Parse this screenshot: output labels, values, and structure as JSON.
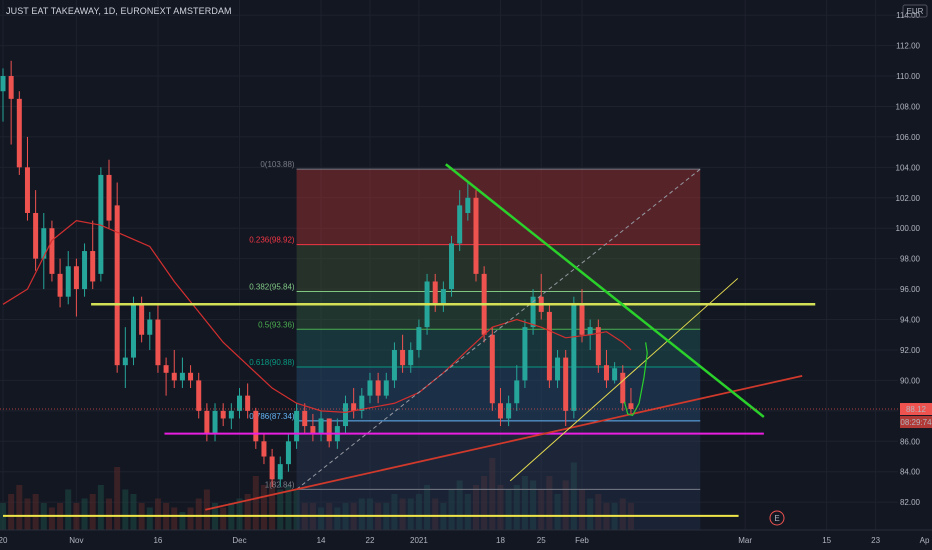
{
  "header": {
    "title": "JUST EAT TAKEAWAY, 1D, EURONEXT AMSTERDAM"
  },
  "currency": "EUR",
  "price_labels": {
    "current": {
      "value": 88.12,
      "text": "88.12",
      "countdown": "08:29:74"
    }
  },
  "event_marker": "E",
  "colors": {
    "background": "#131722",
    "up": "#26a69a",
    "down": "#ef5350",
    "ma": "#d32f2f",
    "green_line": "#2bd12b",
    "lime_line": "#d4e157",
    "magenta_line": "#e91ee0",
    "yellow_line": "#f0e64a",
    "red_trend": "#d0392b"
  },
  "chart_data": {
    "type": "candlestick",
    "title": "JUST EAT TAKEAWAY, 1D, EURONEXT AMSTERDAM",
    "xlabel": "",
    "ylabel": "",
    "ylim": [
      80.2,
      114.6
    ],
    "y_ticks": [
      82,
      84,
      86,
      88,
      90,
      92,
      94,
      96,
      98,
      100,
      102,
      104,
      106,
      108,
      110,
      112,
      114
    ],
    "y_tick_labels": [
      "82.00",
      "84.00",
      "86.00",
      "88.00",
      "90.00",
      "92.00",
      "94.00",
      "96.00",
      "98.00",
      "100.00",
      "102.00",
      "104.00",
      "106.00",
      "108.00",
      "110.00",
      "112.00",
      "114.00"
    ],
    "x_ticks": [
      {
        "label": "20",
        "i": 0
      },
      {
        "label": "Nov",
        "i": 9
      },
      {
        "label": "16",
        "i": 19
      },
      {
        "label": "Dec",
        "i": 29
      },
      {
        "label": "14",
        "i": 39
      },
      {
        "label": "22",
        "i": 45
      },
      {
        "label": "2021",
        "i": 51
      },
      {
        "label": "18",
        "i": 61
      },
      {
        "label": "25",
        "i": 66
      },
      {
        "label": "Feb",
        "i": 71
      },
      {
        "label": "Mar",
        "i": 91
      },
      {
        "label": "15",
        "i": 101
      },
      {
        "label": "23",
        "i": 107
      },
      {
        "label": "Ap",
        "i": 113
      }
    ],
    "candles": [
      {
        "o": 109,
        "h": 110.5,
        "l": 107,
        "c": 110
      },
      {
        "o": 110,
        "h": 111,
        "l": 105.5,
        "c": 108.5
      },
      {
        "o": 108.5,
        "h": 109,
        "l": 103.5,
        "c": 104
      },
      {
        "o": 104,
        "h": 106,
        "l": 100.5,
        "c": 101
      },
      {
        "o": 101,
        "h": 102.5,
        "l": 97.2,
        "c": 98
      },
      {
        "o": 98,
        "h": 101,
        "l": 96,
        "c": 100
      },
      {
        "o": 100,
        "h": 100.5,
        "l": 96.5,
        "c": 97
      },
      {
        "o": 97,
        "h": 98,
        "l": 94.8,
        "c": 95.5
      },
      {
        "o": 95.5,
        "h": 98.5,
        "l": 95,
        "c": 97.5
      },
      {
        "o": 97.5,
        "h": 98,
        "l": 94.2,
        "c": 96
      },
      {
        "o": 96,
        "h": 99,
        "l": 95.5,
        "c": 98.5
      },
      {
        "o": 98.5,
        "h": 100.5,
        "l": 96,
        "c": 96.5
      },
      {
        "o": 97,
        "h": 104,
        "l": 96.5,
        "c": 103.5
      },
      {
        "o": 103.5,
        "h": 104.5,
        "l": 100,
        "c": 100.5
      },
      {
        "o": 101.5,
        "h": 103,
        "l": 90.5,
        "c": 91
      },
      {
        "o": 91,
        "h": 93.5,
        "l": 89.5,
        "c": 91.5
      },
      {
        "o": 91.5,
        "h": 95.5,
        "l": 91,
        "c": 95
      },
      {
        "o": 95,
        "h": 95.5,
        "l": 92.5,
        "c": 93
      },
      {
        "o": 93,
        "h": 94.5,
        "l": 92,
        "c": 94
      },
      {
        "o": 94,
        "h": 95,
        "l": 90.5,
        "c": 91
      },
      {
        "o": 91,
        "h": 91.5,
        "l": 89,
        "c": 90.5
      },
      {
        "o": 90.5,
        "h": 92,
        "l": 89.5,
        "c": 90
      },
      {
        "o": 90,
        "h": 91.5,
        "l": 89.5,
        "c": 90.5
      },
      {
        "o": 90.5,
        "h": 91,
        "l": 89.5,
        "c": 90
      },
      {
        "o": 90,
        "h": 90.5,
        "l": 87.5,
        "c": 88
      },
      {
        "o": 88,
        "h": 88.5,
        "l": 86,
        "c": 86.5
      },
      {
        "o": 86.5,
        "h": 88.5,
        "l": 86,
        "c": 88
      },
      {
        "o": 88,
        "h": 88.5,
        "l": 87,
        "c": 87.5
      },
      {
        "o": 87.5,
        "h": 88.5,
        "l": 86.8,
        "c": 88
      },
      {
        "o": 88,
        "h": 89.5,
        "l": 87.5,
        "c": 89
      },
      {
        "o": 89,
        "h": 89.8,
        "l": 87.5,
        "c": 88
      },
      {
        "o": 88,
        "h": 88.2,
        "l": 85.5,
        "c": 86
      },
      {
        "o": 86,
        "h": 86.5,
        "l": 84.5,
        "c": 85
      },
      {
        "o": 85,
        "h": 85.5,
        "l": 83,
        "c": 83.5
      },
      {
        "o": 83.5,
        "h": 85,
        "l": 83,
        "c": 84.5
      },
      {
        "o": 84.5,
        "h": 86.5,
        "l": 84,
        "c": 86
      },
      {
        "o": 86,
        "h": 88.5,
        "l": 85.5,
        "c": 88
      },
      {
        "o": 88,
        "h": 88.5,
        "l": 86.5,
        "c": 87
      },
      {
        "o": 87,
        "h": 87.8,
        "l": 86,
        "c": 86.5
      },
      {
        "o": 86.5,
        "h": 88,
        "l": 86,
        "c": 87.5
      },
      {
        "o": 87.5,
        "h": 87.5,
        "l": 85.6,
        "c": 86
      },
      {
        "o": 86,
        "h": 87.5,
        "l": 85.5,
        "c": 87
      },
      {
        "o": 87,
        "h": 89,
        "l": 86.5,
        "c": 88.5
      },
      {
        "o": 88.5,
        "h": 89.5,
        "l": 87.5,
        "c": 88
      },
      {
        "o": 88,
        "h": 89.5,
        "l": 87.5,
        "c": 89
      },
      {
        "o": 89,
        "h": 90.5,
        "l": 88.5,
        "c": 90
      },
      {
        "o": 90,
        "h": 90.5,
        "l": 88.5,
        "c": 89
      },
      {
        "o": 89,
        "h": 90.5,
        "l": 88.8,
        "c": 90
      },
      {
        "o": 90,
        "h": 92.5,
        "l": 89.5,
        "c": 92
      },
      {
        "o": 92,
        "h": 93,
        "l": 90.5,
        "c": 91
      },
      {
        "o": 91,
        "h": 92.5,
        "l": 90.5,
        "c": 92
      },
      {
        "o": 92,
        "h": 94,
        "l": 91.5,
        "c": 93.5
      },
      {
        "o": 93.5,
        "h": 97,
        "l": 93,
        "c": 96.5
      },
      {
        "o": 96.5,
        "h": 97,
        "l": 94.5,
        "c": 95
      },
      {
        "o": 95,
        "h": 96.5,
        "l": 94.5,
        "c": 96
      },
      {
        "o": 96,
        "h": 99.5,
        "l": 95.5,
        "c": 99
      },
      {
        "o": 99,
        "h": 102.5,
        "l": 98.5,
        "c": 101.5
      },
      {
        "o": 101,
        "h": 103,
        "l": 100.5,
        "c": 102
      },
      {
        "o": 102,
        "h": 102.5,
        "l": 96.5,
        "c": 97
      },
      {
        "o": 97,
        "h": 97.5,
        "l": 92.5,
        "c": 93
      },
      {
        "o": 93,
        "h": 93.5,
        "l": 88,
        "c": 88.5
      },
      {
        "o": 88.5,
        "h": 89.5,
        "l": 87,
        "c": 87.5
      },
      {
        "o": 87.5,
        "h": 89,
        "l": 87,
        "c": 88.5
      },
      {
        "o": 88.5,
        "h": 91,
        "l": 88,
        "c": 90
      },
      {
        "o": 90,
        "h": 94,
        "l": 89.5,
        "c": 93.5
      },
      {
        "o": 93.5,
        "h": 96,
        "l": 93,
        "c": 95.5
      },
      {
        "o": 95.5,
        "h": 97,
        "l": 94,
        "c": 94.5
      },
      {
        "o": 94.5,
        "h": 95,
        "l": 89.5,
        "c": 90
      },
      {
        "o": 90,
        "h": 92,
        "l": 89.5,
        "c": 91.5
      },
      {
        "o": 91.5,
        "h": 92,
        "l": 87,
        "c": 88
      },
      {
        "o": 88,
        "h": 95.5,
        "l": 87.5,
        "c": 95
      },
      {
        "o": 95,
        "h": 96,
        "l": 92.5,
        "c": 93
      },
      {
        "o": 93,
        "h": 94,
        "l": 92,
        "c": 93.5
      },
      {
        "o": 93.5,
        "h": 94,
        "l": 90.5,
        "c": 91
      },
      {
        "o": 91,
        "h": 92,
        "l": 89.5,
        "c": 90
      },
      {
        "o": 90,
        "h": 91.2,
        "l": 89.8,
        "c": 90.8
      },
      {
        "o": 90.5,
        "h": 91,
        "l": 88,
        "c": 88.5
      },
      {
        "o": 88.5,
        "h": 89.5,
        "l": 87.8,
        "c": 88.12
      }
    ],
    "moving_average": [
      {
        "i": 0,
        "v": 95
      },
      {
        "i": 3,
        "v": 96
      },
      {
        "i": 6,
        "v": 99.2
      },
      {
        "i": 9,
        "v": 100.5
      },
      {
        "i": 12,
        "v": 100.2
      },
      {
        "i": 15,
        "v": 99.5
      },
      {
        "i": 18,
        "v": 98.8
      },
      {
        "i": 21,
        "v": 96.5
      },
      {
        "i": 24,
        "v": 94.5
      },
      {
        "i": 27,
        "v": 92.5
      },
      {
        "i": 30,
        "v": 91
      },
      {
        "i": 33,
        "v": 89.5
      },
      {
        "i": 36,
        "v": 88.5
      },
      {
        "i": 39,
        "v": 88
      },
      {
        "i": 42,
        "v": 87.9
      },
      {
        "i": 45,
        "v": 88.2
      },
      {
        "i": 48,
        "v": 88.5
      },
      {
        "i": 51,
        "v": 89.2
      },
      {
        "i": 54,
        "v": 90.5
      },
      {
        "i": 57,
        "v": 92
      },
      {
        "i": 60,
        "v": 93.5
      },
      {
        "i": 63,
        "v": 94
      },
      {
        "i": 66,
        "v": 93.5
      },
      {
        "i": 69,
        "v": 92.8
      },
      {
        "i": 72,
        "v": 93
      },
      {
        "i": 74,
        "v": 93.2
      },
      {
        "i": 76,
        "v": 92.5
      },
      {
        "i": 77,
        "v": 92
      }
    ],
    "volume": [
      0.3,
      0.4,
      0.5,
      0.35,
      0.4,
      0.3,
      0.25,
      0.3,
      0.45,
      0.3,
      0.35,
      0.4,
      0.5,
      0.35,
      0.7,
      0.45,
      0.4,
      0.3,
      0.25,
      0.35,
      0.3,
      0.25,
      0.2,
      0.25,
      0.35,
      0.45,
      0.3,
      0.25,
      0.3,
      0.35,
      0.4,
      0.6,
      0.5,
      0.55,
      0.45,
      0.5,
      0.45,
      0.3,
      0.3,
      0.25,
      0.3,
      0.25,
      0.3,
      0.3,
      0.35,
      0.35,
      0.3,
      0.3,
      0.4,
      0.35,
      0.35,
      0.4,
      0.5,
      0.35,
      0.3,
      0.45,
      0.55,
      0.4,
      0.5,
      0.6,
      0.8,
      0.5,
      0.45,
      0.5,
      0.6,
      0.55,
      0.45,
      0.6,
      0.4,
      0.55,
      0.75,
      0.45,
      0.35,
      0.4,
      0.3,
      0.3,
      0.35,
      0.3
    ],
    "fibonacci": {
      "high": 103.88,
      "low": 82.84,
      "start_i": 36,
      "end_i": 85.5,
      "levels": [
        {
          "ratio": 0,
          "text": "0(103.88)",
          "price": 103.88,
          "color": "#787b86",
          "fill": "#a83232"
        },
        {
          "ratio": 0.236,
          "text": "0.236(98.92)",
          "price": 98.92,
          "color": "#f23645",
          "fill": "#3d5233"
        },
        {
          "ratio": 0.382,
          "text": "0.382(95.84)",
          "price": 95.84,
          "color": "#81c784",
          "fill": "#2e5c3c"
        },
        {
          "ratio": 0.5,
          "text": "0.5(93.36)",
          "price": 93.36,
          "color": "#4caf50",
          "fill": "#1f5c5c"
        },
        {
          "ratio": 0.618,
          "text": "0.618(90.88)",
          "price": 90.88,
          "color": "#089981",
          "fill": "#264d73"
        },
        {
          "ratio": 0.786,
          "text": "0.786(87.34)",
          "price": 87.34,
          "color": "#64b5f6",
          "fill": "#2a3a55"
        },
        {
          "ratio": 1,
          "text": "1(82.84)",
          "price": 82.84,
          "color": "#787b86",
          "fill": "#24324e"
        }
      ]
    },
    "drawings": {
      "green_downtrend": {
        "x1": 54.3,
        "y1": 104.2,
        "x2": 93.3,
        "y2": 87.6
      },
      "lime_horizontal": {
        "x1": 10.8,
        "x2": 99.6,
        "y": 95.0
      },
      "magenta_horizontal": {
        "x1": 19.8,
        "x2": 93.3,
        "y": 86.5
      },
      "yellow_horizontal": {
        "x1": 0,
        "x2": 90.2,
        "y": 81.1
      },
      "red_uptrend": {
        "x1": 24.8,
        "y1": 81.5,
        "x2": 98,
        "y2": 90.3
      },
      "yellow_uptrend": {
        "x1": 62.2,
        "y1": 83.4,
        "x2": 90.1,
        "y2": 96.7
      },
      "diagonal_dashed": {
        "x1": 36,
        "y1": 82.84,
        "x2": 85.5,
        "y2": 103.88
      }
    }
  }
}
